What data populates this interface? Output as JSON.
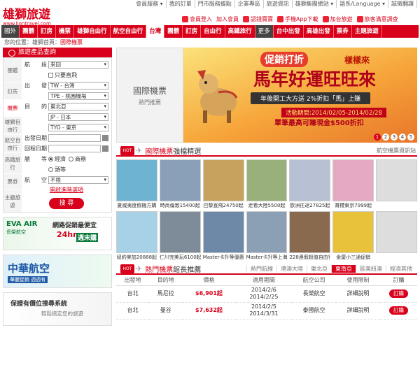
{
  "topbar": [
    "會員服務 ▾",
    "我的訂單",
    "門市服務據點",
    "企業專區",
    "旅遊資訊",
    "雄獅集團網站 ▾",
    "語系/Language ▾",
    "誠徵翻譯"
  ],
  "logo": {
    "name": "雄獅旅遊",
    "url": "www.liontravel.com"
  },
  "quick": [
    "會員登入",
    "加入會員",
    "認錢寶寶",
    "手機App下載",
    "加台旅遊",
    "旅客滿意調查"
  ],
  "nav": [
    {
      "label": "國外",
      "style": "tag"
    },
    {
      "label": "團體"
    },
    {
      "label": "訂房"
    },
    {
      "label": "機票"
    },
    {
      "label": "雄獅自由行"
    },
    {
      "label": "航空自由行"
    },
    {
      "label": "台灣",
      "style": "tag2"
    },
    {
      "label": "團體"
    },
    {
      "label": "訂房"
    },
    {
      "label": "自由行"
    },
    {
      "label": "高鐵旅行"
    },
    {
      "label": "更多",
      "style": "tag"
    },
    {
      "label": "台中出發"
    },
    {
      "label": "高雄出發"
    },
    {
      "label": "票券"
    },
    {
      "label": "主題旅遊"
    }
  ],
  "breadcrumb": {
    "prefix": "您的位置：",
    "home": "雄獅首頁",
    "sep": "：",
    "current": "國際機票"
  },
  "search": {
    "title": "旅遊產品查詢",
    "tabs": [
      "團體",
      "訂房",
      "機票",
      "雄獅自由行",
      "航空自由行",
      "高鐵旅行",
      "票券",
      "主題旅遊"
    ],
    "airline_label": "航　　段",
    "airline_value": "來回",
    "direct_label": "只要直飛",
    "depart_label": "出　　發",
    "depart_region": "TW - 台灣",
    "depart_city": "TPE - 桃園機場",
    "dest_label": "目　　的",
    "dest_region": "東北亞",
    "dest_country": "JP - 日本",
    "dest_city": "TYO - 東京",
    "out_date_label": "出發日期",
    "ret_date_label": "回程日期",
    "class_label": "艙　　等",
    "class_options": [
      "經濟",
      "商務",
      "頭等"
    ],
    "air_label": "航　　空",
    "air_value": "不限",
    "advanced": "開啟進階選項",
    "button": "搜 尋"
  },
  "ads": {
    "ad1": {
      "brand": "EVA AIR",
      "sub": "長榮航空",
      "t1": "網路促銷最便宜",
      "t2": "24hr",
      "t3": "週末購"
    },
    "ad2": {
      "brand": "中華航空",
      "sub": "華麗促銷 週週有"
    },
    "ad3": {
      "t1": "保證有價位搜尋系統",
      "t2": "輕鬆搞定您的旅遊"
    }
  },
  "banner": {
    "left_title": "國際機票",
    "left_sub": "熱門推薦",
    "p1": "促銷打折",
    "p1b": "樣樣來",
    "p2": "馬年好運旺旺來",
    "p3": "年後開工大方送  2%折扣「馬」上賺",
    "p4": "活動期間:2014/02/05-2014/02/28",
    "p5": "單筆最高可賺現金$500折扣",
    "pages": [
      "1",
      "2",
      "3",
      "4",
      "5"
    ],
    "active_page": "1"
  },
  "sec1": {
    "title_hl": "國際機票",
    "title": "強檔精選",
    "more": "航空機票資訊站"
  },
  "deals": [
    "夏威夷度假機方購",
    "時尚倫敦15400起",
    "巴黎直飛24750起",
    "走看大陸5500起",
    "歐洲往返27825起",
    "賞櫻東京7999起",
    "",
    "紐約美加20888起",
    "仁川完美玩6100起",
    "Master卡升等優惠",
    "Master卡升等上海",
    "228連假超值自由行",
    "金廈小三通促銷",
    ""
  ],
  "sec2": {
    "title_hl": "熱門機票",
    "title": "館長推薦",
    "tabs": [
      "熱門航線",
      "港澳大陸",
      "東北亞",
      "東南亞",
      "歐美紐澳",
      "經濟其他"
    ],
    "active_tab": "東南亞",
    "headers": [
      "出發地",
      "目的地",
      "價格",
      "適用期間",
      "航空公司",
      "使用限制",
      "訂購"
    ],
    "rows": [
      {
        "from": "台北",
        "to": "馬尼拉",
        "price": "$6,901起",
        "period": "2014/2/6\n2014/2/25",
        "airline": "長榮航空",
        "limit": "詳細說明",
        "order": "訂購"
      },
      {
        "from": "台北",
        "to": "曼谷",
        "price": "$7,632起",
        "period": "2014/2/5\n2014/3/31",
        "airline": "泰國航空",
        "limit": "詳細說明",
        "order": "訂購"
      }
    ]
  }
}
